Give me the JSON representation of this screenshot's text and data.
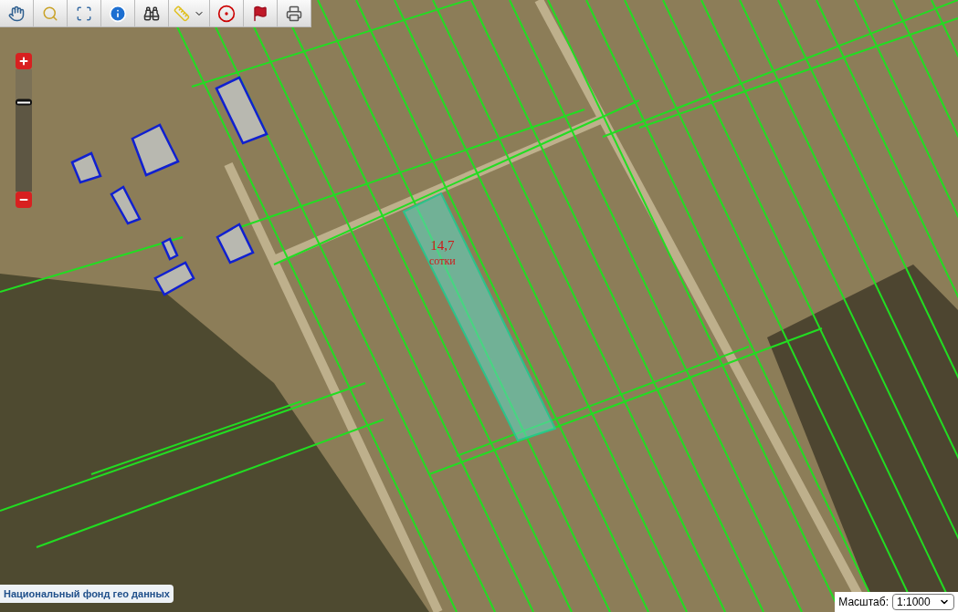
{
  "toolbar": {
    "tools": [
      {
        "kind": "pan"
      },
      {
        "kind": "zoom-box"
      },
      {
        "kind": "zoom-extent"
      },
      {
        "kind": "info"
      },
      {
        "kind": "search"
      },
      {
        "kind": "measure"
      },
      {
        "kind": "point"
      },
      {
        "kind": "flag"
      },
      {
        "kind": "print"
      }
    ]
  },
  "zoom_control": {
    "level": 0.73
  },
  "map": {
    "parcel_label": {
      "area": "14,7",
      "unit": "сотки"
    }
  },
  "attribution": "Национальный фонд гео данных",
  "scale": {
    "label": "Масштаб:",
    "value": "1:1000"
  }
}
